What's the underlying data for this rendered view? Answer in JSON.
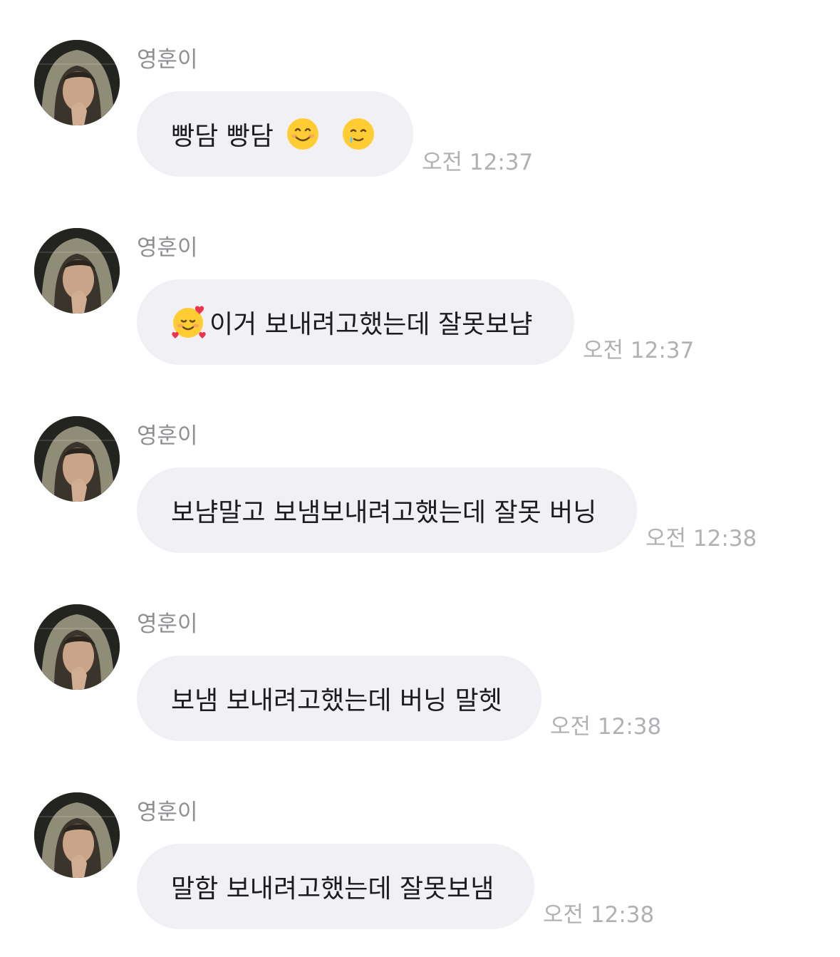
{
  "chat": {
    "messages": [
      {
        "sender": "영훈이",
        "text_a": "빵담 빵담",
        "text_b": "",
        "emoji_1": "smiling-face-icon",
        "emoji_2": "smiling-face-with-tear-icon",
        "time": "오전 12:37"
      },
      {
        "sender": "영훈이",
        "emoji_1": "smiling-face-with-hearts-icon",
        "text_a": "이거 보내려고했는데 잘못보냠",
        "time": "오전 12:37"
      },
      {
        "sender": "영훈이",
        "text_a": "보냠말고 보냄보내려고했는데 잘못 버닝",
        "time": "오전 12:38"
      },
      {
        "sender": "영훈이",
        "text_a": "보냄 보내려고했는데 버닝 말헷",
        "time": "오전 12:38"
      },
      {
        "sender": "영훈이",
        "text_a": "말함 보내려고했는데 잘못보냄",
        "time": "오전 12:38"
      }
    ]
  },
  "colors": {
    "bubble": "#f1f1f5",
    "text": "#1c1c1e",
    "sender": "#8e8e93",
    "timestamp": "#b0b0b5",
    "emoji_face": "#ffcc33",
    "tear": "#6ec3f4",
    "heart": "#e8344c"
  }
}
